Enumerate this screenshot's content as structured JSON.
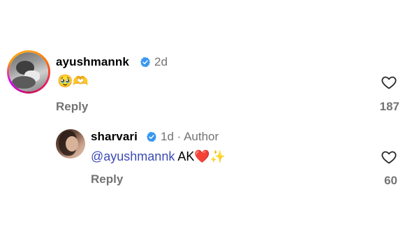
{
  "comment1": {
    "username": "ayushmannk",
    "time": "2d",
    "emojis": "🥹🫶",
    "reply_label": "Reply",
    "like_count": "187"
  },
  "comment2": {
    "username": "sharvari",
    "time": "1d · Author",
    "mention": "@ayushmannk",
    "text_rest": " AK❤️✨",
    "reply_label": "Reply",
    "like_count": "60"
  },
  "colors": {
    "verified": "#3897f0",
    "secondary_text": "#737373",
    "mention": "#3c4ab4"
  },
  "icons": [
    "verified-badge-icon",
    "heart-outline-icon"
  ]
}
